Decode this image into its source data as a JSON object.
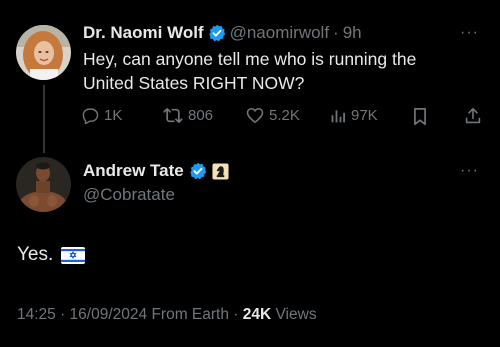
{
  "colors": {
    "background": "#000000",
    "primary_text": "#e7e9ea",
    "secondary_text": "#71767b",
    "verified_blue": "#1d9bf0",
    "thread_line": "#333639"
  },
  "tweet1": {
    "author_name": "Dr. Naomi Wolf",
    "handle": "@naomirwolf",
    "separator": "·",
    "time": "9h",
    "text_line1": "Hey, can anyone tell me who is running the",
    "text_line2": "United States RIGHT NOW?",
    "more": "···",
    "actions": {
      "reply_icon": "comment-icon",
      "reply_count": "1K",
      "retweet_icon": "retweet-icon",
      "retweet_count": "806",
      "like_icon": "heart-icon",
      "like_count": "5.2K",
      "views_icon": "bar-chart-icon",
      "views_count": "97K",
      "bookmark_icon": "bookmark-icon",
      "share_icon": "share-icon"
    }
  },
  "tweet2": {
    "author_name": "Andrew Tate",
    "handle": "@Cobratate",
    "affiliate_badge_icon": "chess-knight-icon",
    "more": "···",
    "text": "Yes.",
    "flag_icon": "israel-flag-icon",
    "timestamp": "14:25 · 16/09/2024 From Earth ·",
    "views_count": "24K",
    "views_label": "Views"
  }
}
